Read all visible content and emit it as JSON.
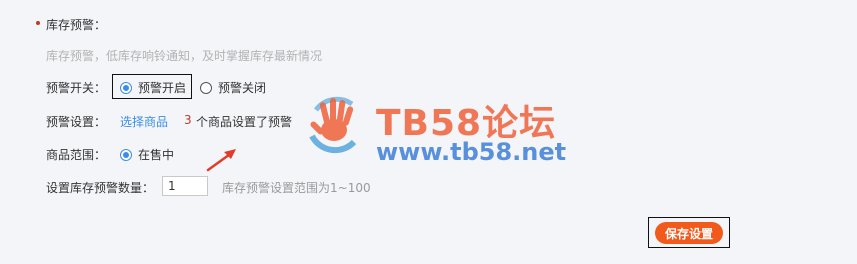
{
  "section": {
    "title": "库存预警：",
    "description": "库存预警，低库存响铃通知，及时掌握库存最新情况"
  },
  "switch": {
    "label": "预警开关：",
    "on_label": "预警开启",
    "off_label": "预警关闭",
    "selected": "预警开启"
  },
  "setting": {
    "label": "预警设置：",
    "link": "选择商品",
    "count": "3",
    "count_suffix": "个商品设置了预警"
  },
  "scope": {
    "label": "商品范围：",
    "option": "在售中"
  },
  "quantity": {
    "label": "设置库存预警数量：",
    "value": "1",
    "hint": "库存预警设置范围为1~100"
  },
  "save_button": "保存设置",
  "watermark": {
    "title": "TB58论坛",
    "url": "www.tb58.net"
  },
  "colors": {
    "accent": "#3a8ee6",
    "button": "#f25a1c",
    "count": "#c0392b"
  }
}
